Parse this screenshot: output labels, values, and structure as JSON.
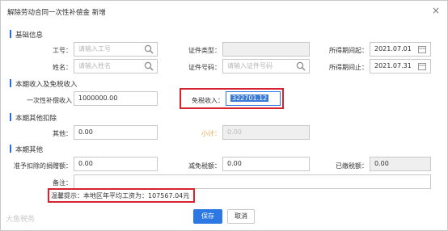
{
  "dialog": {
    "title": "解除劳动合同一次性补偿金 新增",
    "close": "×"
  },
  "sections": {
    "basic": "基础信息",
    "income": "本期收入及免税收入",
    "other_deduct": "本期其他扣除",
    "other": "本期其他"
  },
  "basic": {
    "emp_no_label": "工号：",
    "emp_no_placeholder": "请输入工号",
    "id_type_label": "证件类型：",
    "id_type_value": "",
    "period_start_label": "所得期间起：",
    "period_start_value": "2021.07.01",
    "name_label": "姓名：",
    "name_placeholder": "请输入姓名",
    "id_no_label": "证件号码：",
    "id_no_placeholder": "请输入证件号码",
    "period_end_label": "所得期间止：",
    "period_end_value": "2021.07.31"
  },
  "income": {
    "comp_label": "一次性补偿收入",
    "comp_value": "1000000.00",
    "exempt_label": "免税收入：",
    "exempt_value": "322701.12"
  },
  "deduct": {
    "other_label": "其他：",
    "other_value": "0.00",
    "subtotal_label": "小计：",
    "subtotal_value": "0.00"
  },
  "other": {
    "donation_label": "准予扣除的捐赠额：",
    "donation_value": "0.00",
    "tax_reduce_label": "减免税额：",
    "tax_reduce_value": "0.00",
    "paid_label": "已缴税额：",
    "paid_value": "0.00",
    "remark_label": "备注：",
    "remark_value": ""
  },
  "tip": "温馨提示：本地区年平均工资为：107567.04元",
  "buttons": {
    "save": "保存",
    "cancel": "取消"
  },
  "watermark": "大鱼税务",
  "colors": {
    "accent": "#2b78e4",
    "highlight_border": "#d9232e",
    "subtotal": "#e8a53b"
  }
}
